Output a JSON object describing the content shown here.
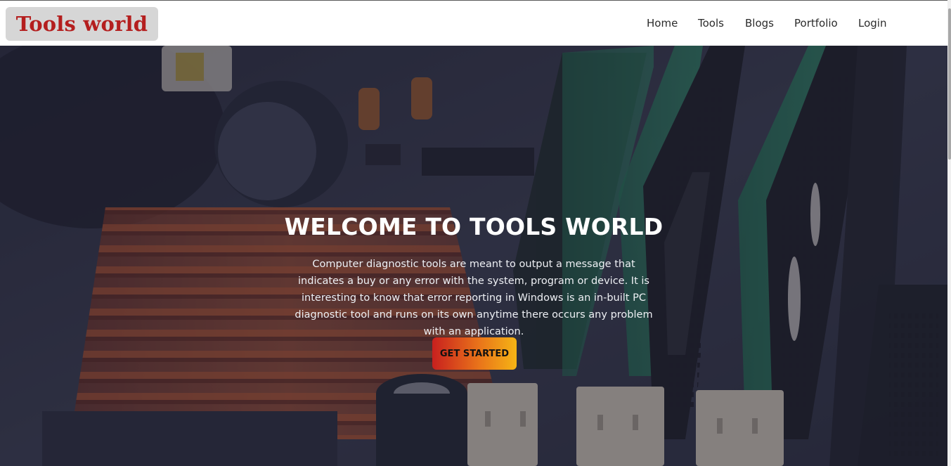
{
  "header": {
    "brand": "Tools world",
    "nav": {
      "home": "Home",
      "tools": "Tools",
      "blogs": "Blogs",
      "portfolio": "Portfolio",
      "login": "Login"
    }
  },
  "hero": {
    "title": "WELCOME TO TOOLS WORLD",
    "text": "Computer diagnostic tools are meant to output a message that indicates a buy or any error with the system, program or device. It is interesting to know that error reporting in Windows is an in-built PC diagnostic tool and runs on its own anytime there occurs any problem with an application.",
    "cta": "GET STARTED",
    "background_image": "circuit-board-ram-modules"
  },
  "colors": {
    "brand_text": "#b41e1e",
    "brand_bg": "#d6d6d6",
    "cta_gradient_start": "#c8201e",
    "cta_gradient_end": "#f5b415"
  }
}
